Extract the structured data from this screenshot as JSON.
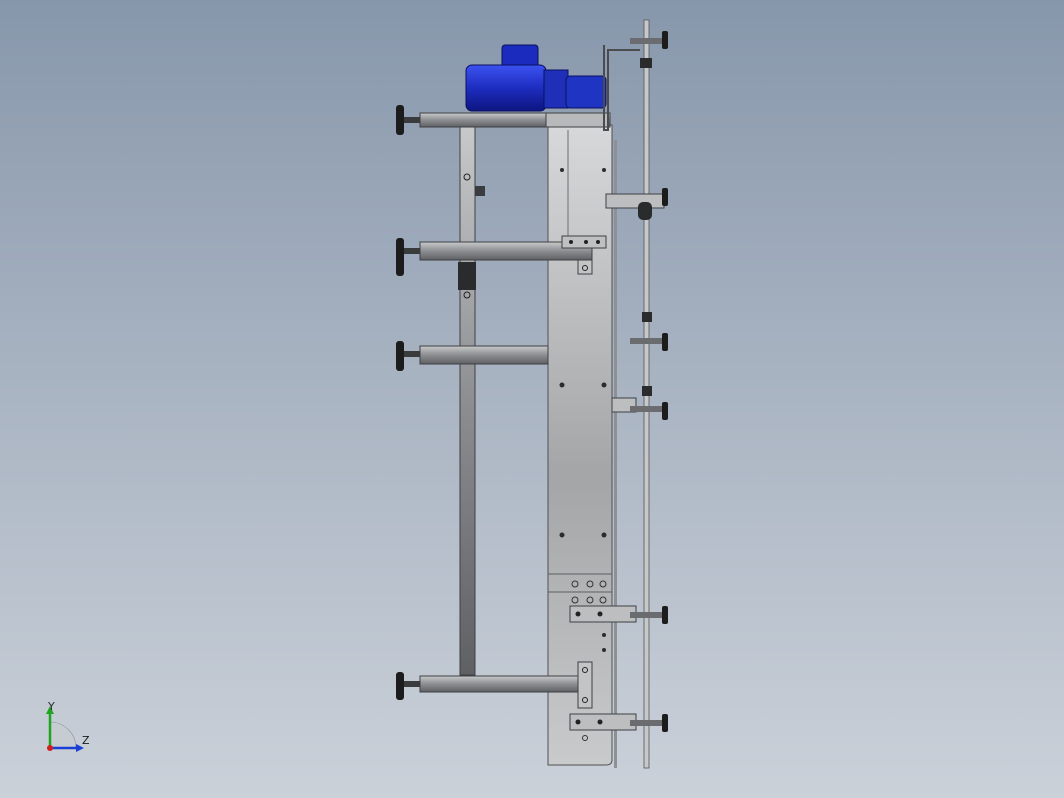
{
  "viewport": {
    "background_top": "#8797ab",
    "background_bottom": "#cbd1d9"
  },
  "model": {
    "motor_color": "#2436c8",
    "steel_color": "#a9aaac",
    "frame_color": "#6d6f73",
    "knob_color": "#1c1c1c"
  },
  "triad": {
    "y_label": "Y",
    "z_label": "Z",
    "y_color": "#1fa41f",
    "z_color": "#1c3fd6",
    "x_color": "#d21d1d"
  }
}
